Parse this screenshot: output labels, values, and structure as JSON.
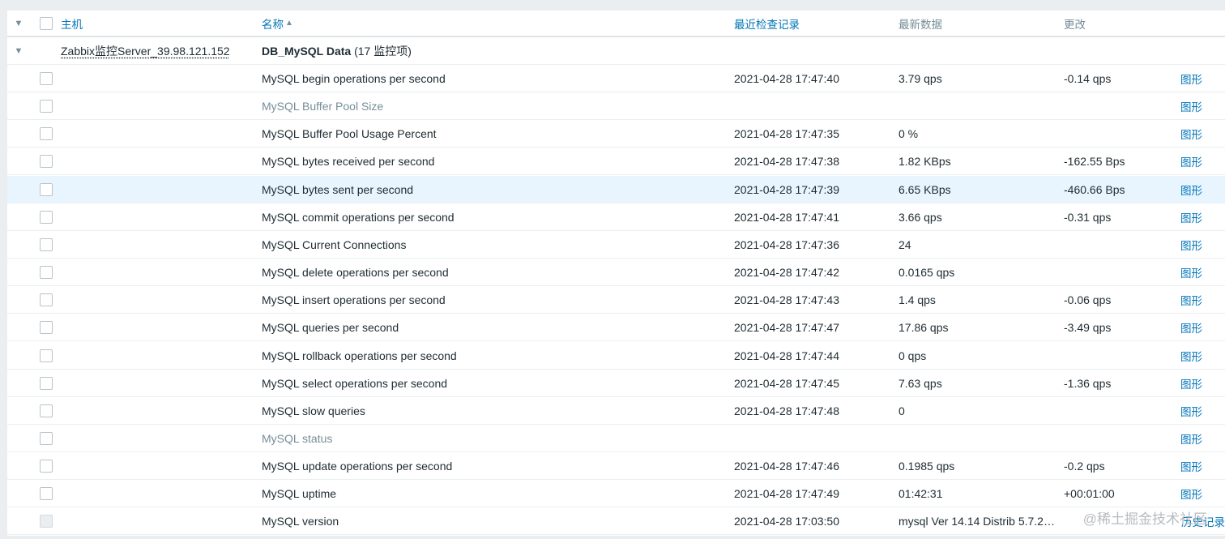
{
  "table": {
    "headers": {
      "host": "主机",
      "name": "名称",
      "sort_indicator": "▲",
      "last_check": "最近检查记录",
      "last_value": "最新数据",
      "change": "更改"
    },
    "group": {
      "host": "Zabbix监控Server_39.98.121.152",
      "application": "DB_MySQL Data",
      "count": "(17 监控项)"
    },
    "items": [
      {
        "name": "MySQL begin operations per second",
        "last_check": "2021-04-28 17:47:40",
        "last_value": "3.79 qps",
        "change": "-0.14 qps",
        "action": "图形"
      },
      {
        "name": "MySQL Buffer Pool Size",
        "last_check": "",
        "last_value": "",
        "change": "",
        "action": "图形"
      },
      {
        "name": "MySQL Buffer Pool Usage Percent",
        "last_check": "2021-04-28 17:47:35",
        "last_value": "0 %",
        "change": "",
        "action": "图形"
      },
      {
        "name": "MySQL bytes received per second",
        "last_check": "2021-04-28 17:47:38",
        "last_value": "1.82 KBps",
        "change": "-162.55 Bps",
        "action": "图形"
      },
      {
        "name": "MySQL bytes sent per second",
        "last_check": "2021-04-28 17:47:39",
        "last_value": "6.65 KBps",
        "change": "-460.66 Bps",
        "action": "图形"
      },
      {
        "name": "MySQL commit operations per second",
        "last_check": "2021-04-28 17:47:41",
        "last_value": "3.66 qps",
        "change": "-0.31 qps",
        "action": "图形"
      },
      {
        "name": "MySQL Current Connections",
        "last_check": "2021-04-28 17:47:36",
        "last_value": "24",
        "change": "",
        "action": "图形"
      },
      {
        "name": "MySQL delete operations per second",
        "last_check": "2021-04-28 17:47:42",
        "last_value": "0.0165 qps",
        "change": "",
        "action": "图形"
      },
      {
        "name": "MySQL insert operations per second",
        "last_check": "2021-04-28 17:47:43",
        "last_value": "1.4 qps",
        "change": "-0.06 qps",
        "action": "图形"
      },
      {
        "name": "MySQL queries per second",
        "last_check": "2021-04-28 17:47:47",
        "last_value": "17.86 qps",
        "change": "-3.49 qps",
        "action": "图形"
      },
      {
        "name": "MySQL rollback operations per second",
        "last_check": "2021-04-28 17:47:44",
        "last_value": "0 qps",
        "change": "",
        "action": "图形"
      },
      {
        "name": "MySQL select operations per second",
        "last_check": "2021-04-28 17:47:45",
        "last_value": "7.63 qps",
        "change": "-1.36 qps",
        "action": "图形"
      },
      {
        "name": "MySQL slow queries",
        "last_check": "2021-04-28 17:47:48",
        "last_value": "0",
        "change": "",
        "action": "图形"
      },
      {
        "name": "MySQL status",
        "last_check": "",
        "last_value": "",
        "change": "",
        "action": "图形"
      },
      {
        "name": "MySQL update operations per second",
        "last_check": "2021-04-28 17:47:46",
        "last_value": "0.1985 qps",
        "change": "-0.2 qps",
        "action": "图形"
      },
      {
        "name": "MySQL uptime",
        "last_check": "2021-04-28 17:47:49",
        "last_value": "01:42:31",
        "change": "+00:01:00",
        "action": "图形"
      },
      {
        "name": "MySQL version",
        "last_check": "2021-04-28 17:03:50",
        "last_value": "mysql Ver 14.14 Distrib 5.7.2…",
        "change": "",
        "action": "历史记录"
      }
    ]
  },
  "watermark": "@稀土掘金技术社区",
  "colors": {
    "link": "#0275b8",
    "muted": "#768d99",
    "hover_row": "#e8f5ff",
    "background": "#ebeef0"
  }
}
